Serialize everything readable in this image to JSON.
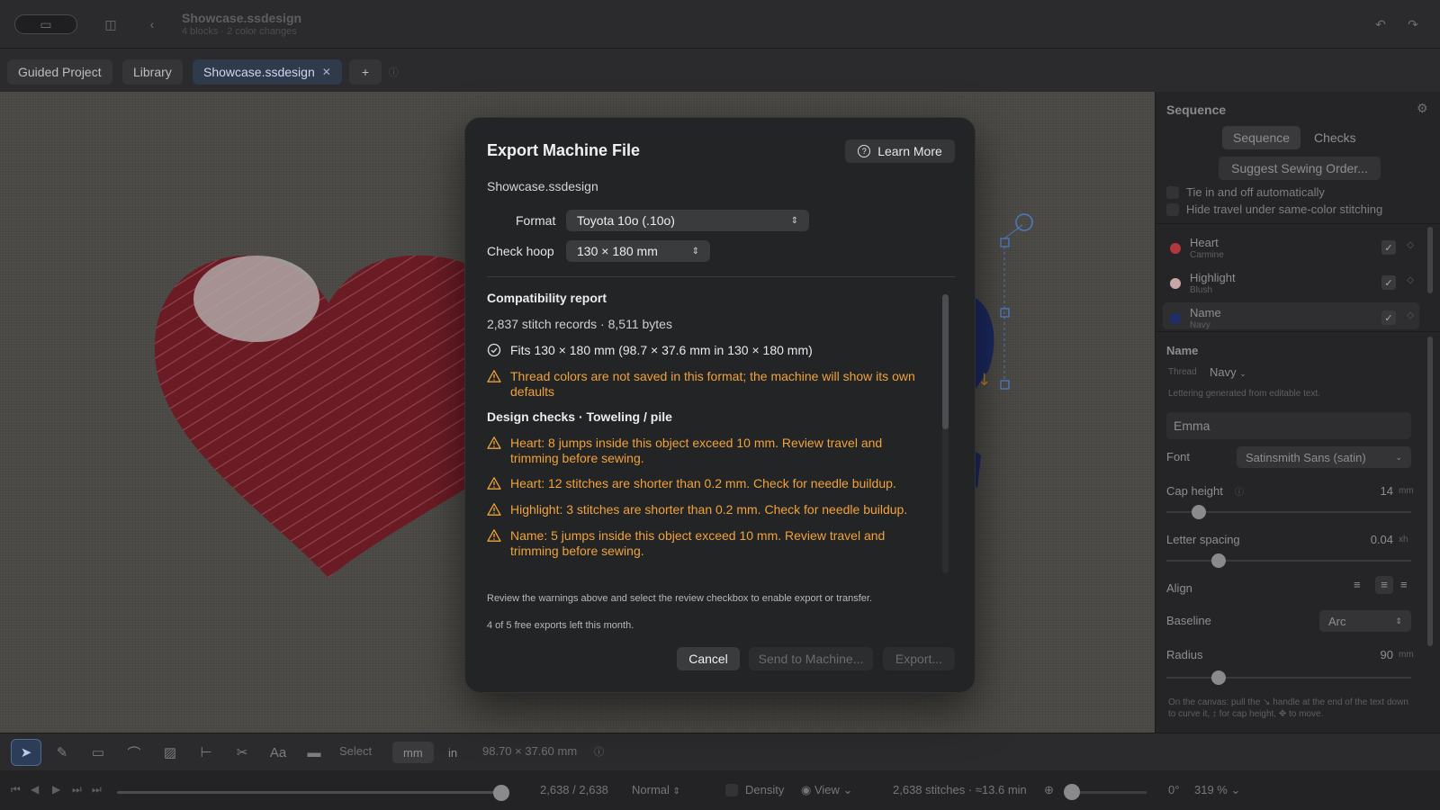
{
  "titlebar": {
    "doc_title": "Showcase.ssdesign",
    "doc_subtitle": "4 blocks · 2 color changes"
  },
  "tabs": [
    {
      "label": "Guided Project"
    },
    {
      "label": "Library"
    },
    {
      "label": "Showcase.ssdesign",
      "active": true
    },
    {
      "label": "+"
    }
  ],
  "modal": {
    "title": "Export Machine File",
    "learn_more": "Learn More",
    "file_name": "Showcase.ssdesign",
    "format_label": "Format",
    "format_value": "Toyota 10o (.10o)",
    "hoop_label": "Check hoop",
    "hoop_value": "130 × 180 mm",
    "report_title": "Compatibility report",
    "report_stats": "2,837 stitch records · 8,511 bytes",
    "fit_item": "Fits 130 × 180 mm (98.7 × 37.6 mm in 130 × 180 mm)",
    "color_warning": "Thread colors are not saved in this format; the machine will show its own defaults",
    "design_checks_title": "Design checks · Toweling / pile",
    "checks": [
      "Heart: 8 jumps inside this object exceed 10 mm. Review travel and trimming before sewing.",
      "Heart: 12 stitches are shorter than 0.2 mm. Check for needle buildup.",
      "Highlight: 3 stitches are shorter than 0.2 mm. Check for needle buildup.",
      "Name: 5 jumps inside this object exceed 10 mm. Review travel and trimming before sewing."
    ],
    "review_note": "Review the warnings above and select the review checkbox to enable export or transfer.",
    "exports_left": "4 of 5 free exports left this month.",
    "cancel": "Cancel",
    "send": "Send to Machine...",
    "export": "Export..."
  },
  "panel": {
    "title": "Sequence",
    "seg_sequence": "Sequence",
    "seg_checks": "Checks",
    "suggest": "Suggest Sewing Order...",
    "tie_in": "Tie in and off automatically",
    "hide_travel": "Hide travel under same-color stitching",
    "objects": [
      {
        "name": "Heart",
        "color_name": "Carmine",
        "color": "#b0373e"
      },
      {
        "name": "Highlight",
        "color_name": "Blush",
        "color": "#c9a7a8"
      },
      {
        "name": "Name",
        "color_name": "Navy",
        "color": "#1f2e6b"
      }
    ],
    "section_title": "Name",
    "thread_label": "Thread",
    "thread_value": "Navy",
    "lettering_note": "Lettering generated from editable text.",
    "text_value": "Emma",
    "font_label": "Font",
    "font_value": "Satinsmith Sans (satin)",
    "cap_label": "Cap height",
    "cap_value": "14",
    "cap_unit": "mm",
    "spacing_label": "Letter spacing",
    "spacing_value": "0.04",
    "spacing_unit": "xh",
    "align_label": "Align",
    "baseline_label": "Baseline",
    "baseline_value": "Arc",
    "radius_label": "Radius",
    "radius_value": "90",
    "radius_unit": "mm",
    "hint": "On the canvas: pull the ↘ handle at the end of the text down to curve it, ↕ for cap height, ✥ to move."
  },
  "toolbar": {
    "select_label": "Select",
    "unit_mm": "mm",
    "unit_in": "in",
    "dimensions": "98.70 × 37.60 mm"
  },
  "playback": {
    "position": "2,638 / 2,638",
    "speed": "Normal",
    "density": "Density",
    "view": "View",
    "stats": "2,638 stitches · ≈13.6 min",
    "rotation": "0°",
    "zoom": "319 %"
  }
}
